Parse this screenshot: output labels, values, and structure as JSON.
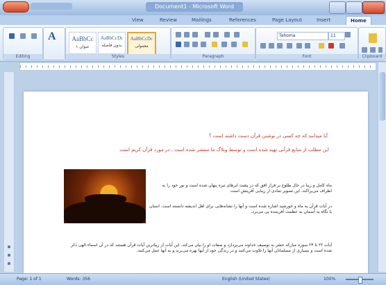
{
  "window": {
    "title": "Document1 - Microsoft Word"
  },
  "tabs": [
    {
      "label": "Home"
    },
    {
      "label": "Insert"
    },
    {
      "label": "Page Layout"
    },
    {
      "label": "References"
    },
    {
      "label": "Mailings"
    },
    {
      "label": "Review"
    },
    {
      "label": "View"
    }
  ],
  "ribbon": {
    "clipboard_label": "Paste",
    "font_name": "Tahoma",
    "font_size": "11",
    "styles": [
      {
        "sample": "AaBbCc",
        "name": "عنوان ۱"
      },
      {
        "sample": "AaBbCcDc",
        "name": "بدون فاصله"
      },
      {
        "sample": "AaBbCcDc",
        "name": "معمولی"
      }
    ],
    "groups": {
      "clipboard": "Clipboard",
      "font": "Font",
      "paragraph": "Paragraph",
      "styles": "Styles",
      "editing": "Editing"
    }
  },
  "document": {
    "heading1": "آیا میدانید که چه کسی در نوشتن قرآن دست داشته است ؟",
    "heading2": "این مطلب از منابع قرآنی تهیه شده است و توسط وبلاگ ما منتشر شده است ، در مورد قرآن کریم است",
    "para1": "ماه کامل و زیبا در حال طلوع بر فراز افق که در پشت ابرهای تیره پنهان شده است و نور خود را به اطراف می‌پراکند، این تصویر نمادی از زیبایی آفرینش است.",
    "para2": "در آیات قرآن به ماه و خورشید اشاره شده است و آنها را نشانه‌هایی برای اهل اندیشه دانسته است. انسان با نگاه به آسمان به عظمت آفریننده پی می‌برد.",
    "para3": "آیات ۲۲ تا ۲۴ سوره مبارکه حشر به توصیف خداوند می‌پردازد و صفات او را بیان می‌کند. این آیات از زیباترین آیات قرآن هستند که در آن اسماء الهی ذکر شده است و بسیاری از مسلمانان آنها را تلاوت می‌کنند و در زندگی خود از آنها بهره می‌برند و به آنها عمل می‌کنند.",
    "image": "sunset-photo"
  },
  "status": {
    "page": "Page: 1 of 1",
    "words": "Words: 356",
    "language": "English (United States)",
    "zoom": "100%"
  }
}
